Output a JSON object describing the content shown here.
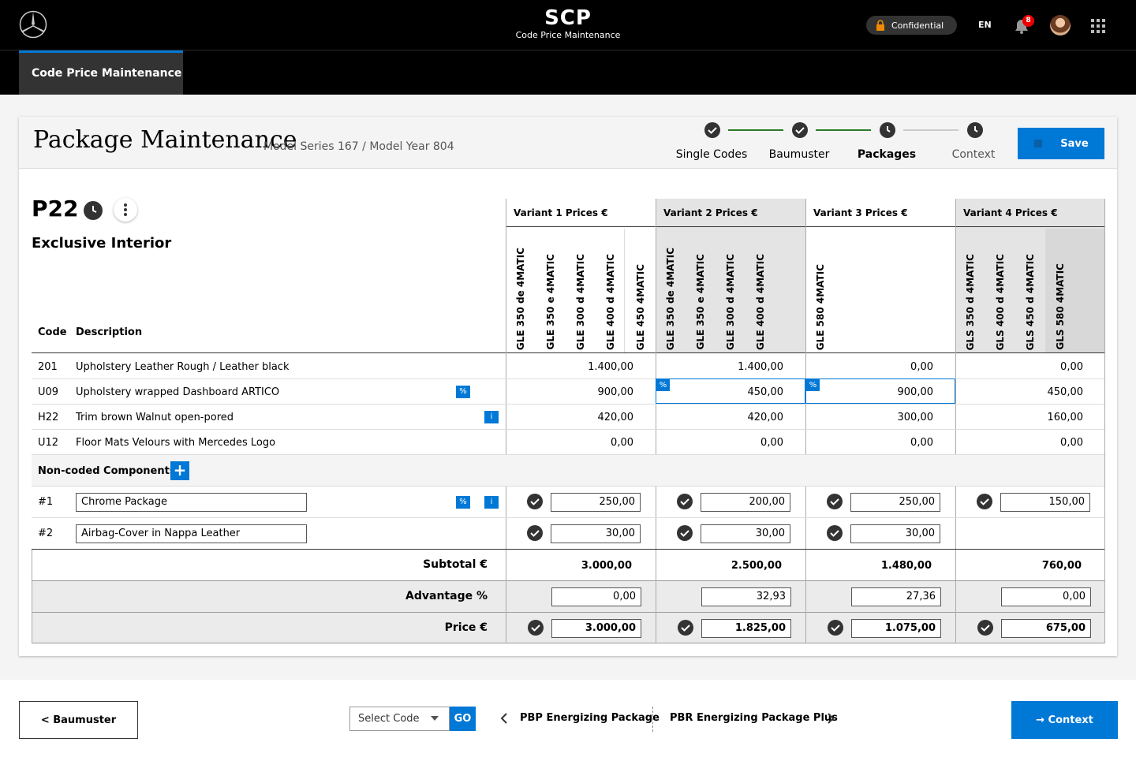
{
  "header": {
    "app_title": "SCP",
    "app_subtitle": "Code Price Maintenance",
    "confidential_label": "Confidential",
    "language": "EN",
    "notification_count": "8"
  },
  "subnav": {
    "tab_label": "Code Price Maintenance"
  },
  "card": {
    "title": "Package Maintenance",
    "breadcrumb": "Model Series 167 / Model Year 804",
    "steps": [
      {
        "label": "Single Codes",
        "state": "done"
      },
      {
        "label": "Baumuster",
        "state": "done"
      },
      {
        "label": "Packages",
        "state": "active"
      },
      {
        "label": "Context",
        "state": "pending"
      }
    ],
    "save_label": "Save"
  },
  "package": {
    "code": "P22",
    "name": "Exclusive Interior"
  },
  "table": {
    "code_header": "Code",
    "description_header": "Description",
    "variants": [
      {
        "label": "Variant 1 Prices €",
        "models": [
          "GLE 350 de 4MATIC",
          "GLE 350 e 4MATIC",
          "GLE 300 d 4MATIC",
          "GLE 400 d 4MATIC",
          "GLE 450 4MATIC"
        ]
      },
      {
        "label": "Variant 2 Prices €",
        "models": [
          "GLE 350 de 4MATIC",
          "GLE 350 e 4MATIC",
          "GLE 300 d 4MATIC",
          "GLE 400 d 4MATIC"
        ]
      },
      {
        "label": "Variant 3 Prices €",
        "models": [
          "GLE 580 4MATIC"
        ]
      },
      {
        "label": "Variant 4 Prices €",
        "models": [
          "GLS 350 d 4MATIC",
          "GLS 400 d 4MATIC",
          "GLS 450 d 4MATIC",
          "GLS 580 4MATIC"
        ]
      }
    ],
    "rows": [
      {
        "code": "201",
        "description": "Upholstery Leather Rough / Leather black",
        "prices": [
          "1.400,00",
          "1.400,00",
          "0,00",
          "0,00"
        ]
      },
      {
        "code": "U09",
        "description": "Upholstery wrapped Dashboard ARTICO",
        "prices": [
          "900,00",
          "450,00",
          "900,00",
          "450,00"
        ]
      },
      {
        "code": "H22",
        "description": "Trim brown Walnut open-pored",
        "prices": [
          "420,00",
          "420,00",
          "300,00",
          "160,00"
        ]
      },
      {
        "code": "U12",
        "description": "Floor Mats Velours with Mercedes Logo",
        "prices": [
          "0,00",
          "0,00",
          "0,00",
          "0,00"
        ]
      }
    ],
    "noncoded_label": "Non-coded Components",
    "noncoded": [
      {
        "code": "#1",
        "description": "Chrome Package",
        "prices": [
          "250,00",
          "200,00",
          "250,00",
          "150,00"
        ]
      },
      {
        "code": "#2",
        "description": "Airbag-Cover in Nappa Leather",
        "prices": [
          "30,00",
          "30,00",
          "30,00",
          ""
        ]
      }
    ],
    "subtotal_label": "Subtotal €",
    "subtotals": [
      "3.000,00",
      "2.500,00",
      "1.480,00",
      "760,00"
    ],
    "advantage_label": "Advantage %",
    "advantages": [
      "0,00",
      "32,93",
      "27,36",
      "0,00"
    ],
    "price_label": "Price €",
    "prices": [
      "3.000,00",
      "1.825,00",
      "1.075,00",
      "675,00"
    ]
  },
  "footer": {
    "back_label": "< Baumuster",
    "select_placeholder": "Select Code",
    "go_label": "GO",
    "prev_package": "PBP Energizing Package",
    "next_package": "PBR Energizing Package Plus",
    "context_label": "→ Context"
  },
  "colors": {
    "accent": "#0078d6",
    "step_done_line": "#2a7a2a"
  }
}
